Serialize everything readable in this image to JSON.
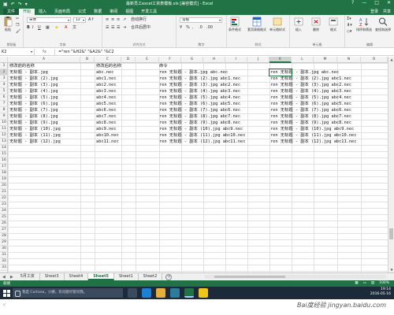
{
  "window": {
    "title": "最新员工excel工资表模板.xls [兼容模式] - Excel",
    "qat_icons": [
      "save-icon",
      "undo-icon",
      "redo-icon",
      "customize-icon"
    ],
    "controls": [
      "?",
      "—",
      "□",
      "✕"
    ]
  },
  "ribbon_tabs": [
    "文件",
    "开始",
    "插入",
    "页面布局",
    "公式",
    "数据",
    "审阅",
    "视图",
    "开发工具"
  ],
  "ribbon_tabs_active": "开始",
  "ribbon_right": {
    "login": "登录",
    "share": "共享"
  },
  "ribbon": {
    "clipboard": {
      "paste": "粘贴",
      "label": "剪贴板"
    },
    "font": {
      "name": "宋体",
      "size": "12",
      "bold": "B",
      "italic": "I",
      "underline": "U",
      "label": "字体"
    },
    "align": {
      "wrap": "自动换行",
      "merge": "合并后居中",
      "label": "对齐方式"
    },
    "number": {
      "format": "常规",
      "label": "数字"
    },
    "styles": {
      "cond": "条件格式",
      "table": "套用表格格式",
      "cell": "单元格样式",
      "label": "样式"
    },
    "cells": {
      "insert": "插入",
      "delete": "删除",
      "format": "格式",
      "label": "单元格"
    },
    "editing": {
      "sort": "排序和筛选",
      "find": "查找和选择",
      "label": "编辑"
    }
  },
  "formula_bar": {
    "name_box": "K2",
    "fx": "fx",
    "formula": "=\"ren \"&H2&\" \"&A2&\" \"&C2"
  },
  "columns": [
    "A",
    "B",
    "C",
    "D",
    "E",
    "F",
    "G",
    "H",
    "I",
    "J",
    "K",
    "L",
    "M",
    "N",
    "O"
  ],
  "selected_column": "K",
  "rows": [
    "1",
    "2",
    "3",
    "4",
    "5",
    "6",
    "7",
    "8",
    "9",
    "10",
    "11",
    "12",
    "13",
    "14",
    "15",
    "16",
    "17",
    "18",
    "19",
    "20",
    "21",
    "22",
    "23",
    "24",
    "25",
    "26",
    "27",
    "28",
    "29",
    "30",
    "31",
    "32",
    "33"
  ],
  "selected_row": "2",
  "headers": {
    "a": "修改前的名称",
    "c": "修改后的名称",
    "h": "命令"
  },
  "data": [
    {
      "a": "无标题 - 副本.jpg",
      "c": "abc.nec",
      "h": "ren 无标题 - 副本.jpg abc.nec",
      "k": "ren 无标题 - 副本.jpg abc.nec"
    },
    {
      "a": "无标题 - 副本 (2).jpg",
      "c": "abc1.nec",
      "h": "ren 无标题 - 副本 (2).jpg abc1.nec",
      "k": "ren 无标题 - 副本 (2).jpg abc1.nec"
    },
    {
      "a": "无标题 - 副本 (3).jpg",
      "c": "abc2.nec",
      "h": "ren 无标题 - 副本 (3).jpg abc2.nec",
      "k": "ren 无标题 - 副本 (3).jpg abc2.nec"
    },
    {
      "a": "无标题 - 副本 (4).jpg",
      "c": "abc3.nec",
      "h": "ren 无标题 - 副本 (4).jpg abc3.nec",
      "k": "ren 无标题 - 副本 (4).jpg abc3.nec"
    },
    {
      "a": "无标题 - 副本 (5).jpg",
      "c": "abc4.nec",
      "h": "ren 无标题 - 副本 (5).jpg abc4.nec",
      "k": "ren 无标题 - 副本 (5).jpg abc4.nec"
    },
    {
      "a": "无标题 - 副本 (6).jpg",
      "c": "abc5.nec",
      "h": "ren 无标题 - 副本 (6).jpg abc5.nec",
      "k": "ren 无标题 - 副本 (6).jpg abc5.nec"
    },
    {
      "a": "无标题 - 副本 (7).jpg",
      "c": "abc6.nec",
      "h": "ren 无标题 - 副本 (7).jpg abc6.nec",
      "k": "ren 无标题 - 副本 (7).jpg abc6.nec"
    },
    {
      "a": "无标题 - 副本 (8).jpg",
      "c": "abc7.nec",
      "h": "ren 无标题 - 副本 (8).jpg abc7.nec",
      "k": "ren 无标题 - 副本 (8).jpg abc7.nec"
    },
    {
      "a": "无标题 - 副本 (9).jpg",
      "c": "abc8.nec",
      "h": "ren 无标题 - 副本 (9).jpg abc8.nec",
      "k": "ren 无标题 - 副本 (9).jpg abc8.nec"
    },
    {
      "a": "无标题 - 副本 (10).jpg",
      "c": "abc9.nec",
      "h": "ren 无标题 - 副本 (10).jpg abc9.nec",
      "k": "ren 无标题 - 副本 (10).jpg abc9.nec"
    },
    {
      "a": "无标题 - 副本 (11).jpg",
      "c": "abc10.nec",
      "h": "ren 无标题 - 副本 (11).jpg abc10.nec",
      "k": "ren 无标题 - 副本 (11).jpg abc10.nec"
    },
    {
      "a": "无标题 - 副本 (12).jpg",
      "c": "abc11.nec",
      "h": "ren 无标题 - 副本 (12).jpg abc11.nec",
      "k": "ren 无标题 - 副本 (12).jpg abc11.nec"
    }
  ],
  "sheet_tabs": [
    "5月工资",
    "Sheet3",
    "Sheet4",
    "Sheet5",
    "Sheet1",
    "Sheet2"
  ],
  "active_sheet": "Sheet5",
  "status": {
    "left": "就绪",
    "zoom": "100%"
  },
  "taskbar": {
    "search_placeholder": "我是 Cortana，小娜。有问题尽管问我。",
    "time": "19:14",
    "date": "2016-05-16"
  },
  "footer": {
    "left": "ﾍﾞ",
    "watermark": "Bai度经验 jingyan.baidu.com"
  },
  "colors": {
    "excel_green": "#217346",
    "taskbar": "#1d2a3a"
  }
}
